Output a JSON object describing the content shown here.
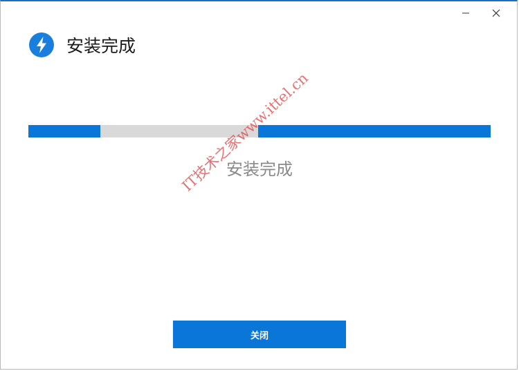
{
  "window": {
    "controls": {
      "minimize_icon": "minimize-icon",
      "close_icon": "close-icon"
    }
  },
  "header": {
    "icon": "lightning-bolt-icon",
    "title": "安装完成"
  },
  "progress": {
    "segments": [
      {
        "state": "filled",
        "start": 0.0,
        "end": 0.156
      },
      {
        "state": "empty",
        "start": 0.156,
        "end": 0.497
      },
      {
        "state": "filled",
        "start": 0.497,
        "end": 1.0
      }
    ]
  },
  "status": {
    "text": "安装完成"
  },
  "watermark": {
    "text": "IT技术之家www.ittel.cn"
  },
  "footer": {
    "close_label": "关闭"
  },
  "colors": {
    "accent": "#0a77d8",
    "track": "#d9d9d9",
    "status_text": "#8a8a8a",
    "watermark": "#dc3c3c"
  }
}
